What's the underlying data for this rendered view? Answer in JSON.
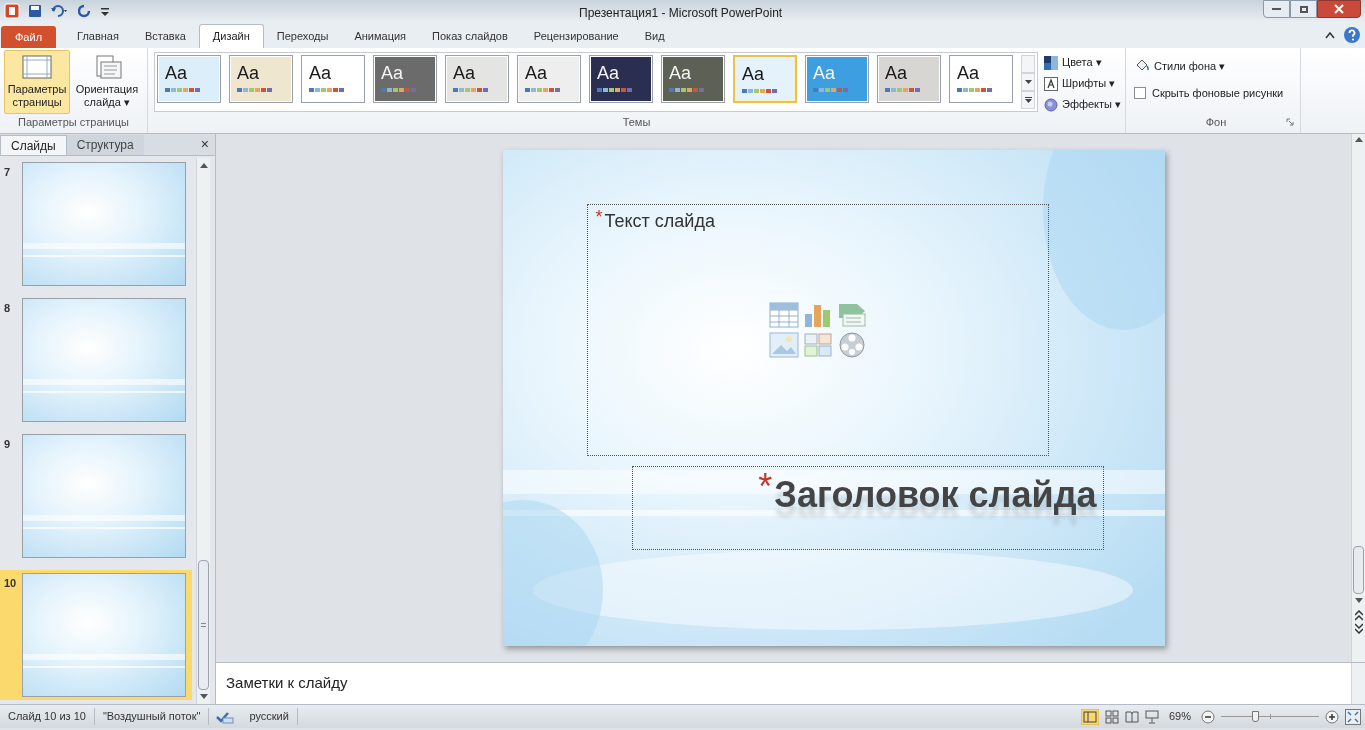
{
  "window": {
    "title": "Презентация1  -  Microsoft PowerPoint"
  },
  "ribbon_tabs": [
    {
      "label": "Файл",
      "kind": "file",
      "selected": false
    },
    {
      "label": "Главная",
      "kind": "tab",
      "selected": false
    },
    {
      "label": "Вставка",
      "kind": "tab",
      "selected": false
    },
    {
      "label": "Дизайн",
      "kind": "tab",
      "selected": true
    },
    {
      "label": "Переходы",
      "kind": "tab",
      "selected": false
    },
    {
      "label": "Анимация",
      "kind": "tab",
      "selected": false
    },
    {
      "label": "Показ слайдов",
      "kind": "tab",
      "selected": false
    },
    {
      "label": "Рецензирование",
      "kind": "tab",
      "selected": false
    },
    {
      "label": "Вид",
      "kind": "tab",
      "selected": false
    }
  ],
  "page_setup_group": {
    "buttons": [
      {
        "label": "Параметры страницы",
        "selected": true
      },
      {
        "label": "Ориентация слайда ▾",
        "selected": false
      }
    ],
    "caption": "Параметры страницы"
  },
  "themes_group": {
    "caption": "Темы",
    "themes": [
      {
        "label": "Aa",
        "color": "#dbeef9",
        "selected": false
      },
      {
        "label": "Aa",
        "color": "#efe6cf",
        "selected": false
      },
      {
        "label": "Aa",
        "color": "#ffffff",
        "selected": false
      },
      {
        "label": "Aa",
        "color": "#6b6b6b",
        "selected": false
      },
      {
        "label": "Aa",
        "color": "#e4e4e2",
        "selected": false
      },
      {
        "label": "Aa",
        "color": "#eeeeee",
        "selected": false
      },
      {
        "label": "Aa",
        "color": "#2a2f52",
        "selected": false
      },
      {
        "label": "Aa",
        "color": "#5d6055",
        "selected": false
      },
      {
        "label": "Aa",
        "color": "#e3f2fb",
        "selected": true
      },
      {
        "label": "Aa",
        "color": "#3d9fe0",
        "selected": false
      },
      {
        "label": "Aa",
        "color": "#d8d6d2",
        "selected": false
      },
      {
        "label": "Aa",
        "color": "#ffffff",
        "selected": false
      }
    ],
    "options": [
      {
        "label": "Цвета ▾",
        "kind": "colors"
      },
      {
        "label": "Шрифты ▾",
        "kind": "fonts"
      },
      {
        "label": "Эффекты ▾",
        "kind": "effects"
      }
    ]
  },
  "background_group": {
    "styles_button": "Стили фона ▾",
    "hide_graphics": {
      "label": "Скрыть фоновые рисунки",
      "checked": false
    },
    "caption": "Фон"
  },
  "slides_pane": {
    "tabs": [
      {
        "label": "Слайды",
        "selected": true
      },
      {
        "label": "Структура",
        "selected": false
      }
    ],
    "close": "×",
    "slides": [
      {
        "number": "7",
        "selected": false
      },
      {
        "number": "8",
        "selected": false
      },
      {
        "number": "9",
        "selected": false
      },
      {
        "number": "10",
        "selected": true
      }
    ]
  },
  "slide": {
    "content_placeholder": "Текст слайда",
    "title_placeholder": "Заголовок слайда",
    "marker": "*"
  },
  "notes": {
    "placeholder": "Заметки к слайду"
  },
  "status_bar": {
    "slide": "Слайд 10 из 10",
    "theme": "\"Воздушный поток\"",
    "language": "русский",
    "zoom": "69%",
    "zoom_slider": {
      "level": 0.34
    }
  }
}
